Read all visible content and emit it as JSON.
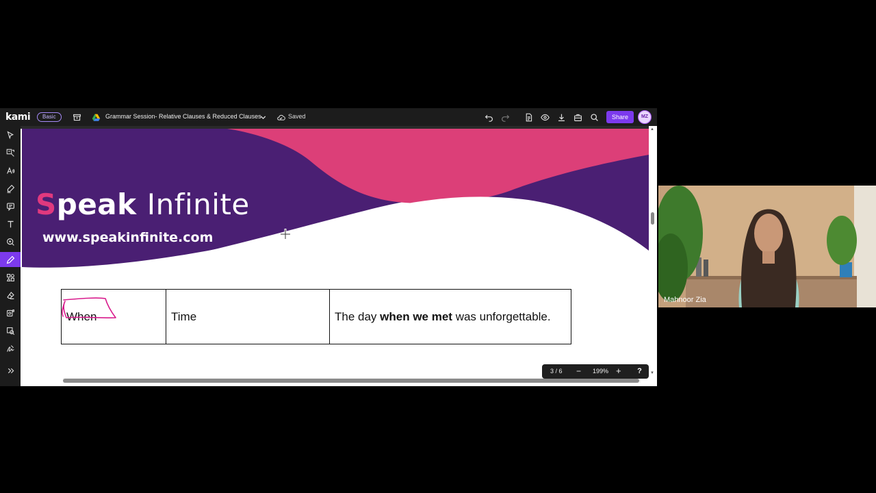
{
  "app": {
    "logo": "kami",
    "plan_badge": "Basic",
    "document_title": "Grammar Session-  Relative Clauses & Reduced Clauses",
    "save_status": "Saved",
    "share_label": "Share",
    "avatar_initials": "MZ",
    "accent_color": "#7c3aed"
  },
  "toolbar": {
    "tools": [
      "select-icon",
      "ocr-icon",
      "text-to-speech-icon",
      "highlighter-icon",
      "comment-icon",
      "text-icon",
      "shape-icon",
      "drawing-icon",
      "add-media-icon",
      "eraser-icon",
      "dictionary-icon",
      "capture-icon",
      "signature-icon",
      "expand-icon"
    ],
    "active_tool": "drawing-icon"
  },
  "slide": {
    "brand_s": "S",
    "brand_peak": "peak",
    "brand_infinite": "Infinite",
    "url": "www.speakinfinite.com",
    "colors": {
      "purple": "#4a1f73",
      "pink": "#dc3f78"
    }
  },
  "table": {
    "row": {
      "word": "When",
      "category": "Time",
      "example_pre": "The day ",
      "example_bold": "when we met",
      "example_post": " was unforgettable."
    }
  },
  "viewer": {
    "page_indicator": "3 / 6",
    "zoom_level": "199%",
    "zoom_out": "−",
    "zoom_in": "+",
    "help": "?"
  },
  "participant": {
    "name": "Mahnoor Zia"
  }
}
